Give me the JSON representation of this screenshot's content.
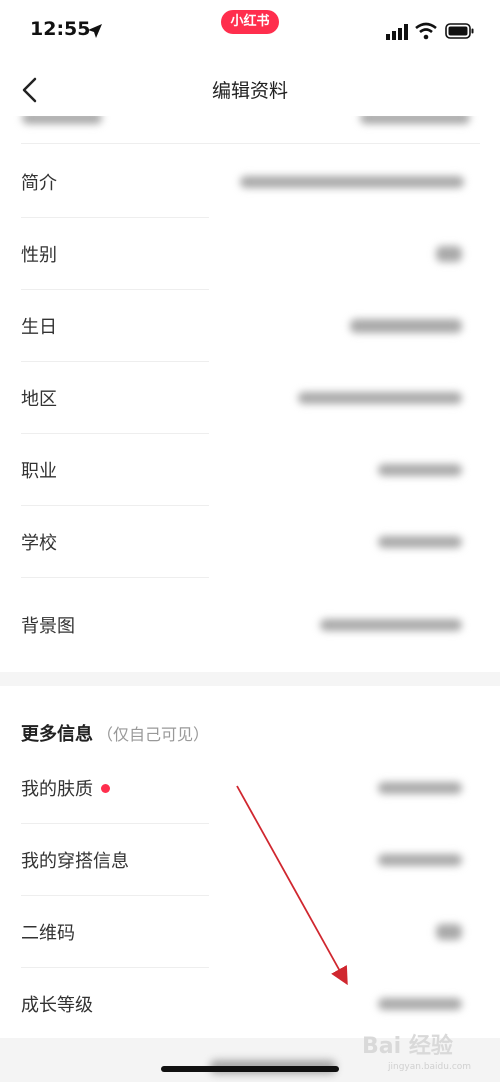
{
  "status_bar": {
    "time": "12:55",
    "app_badge": "小红书"
  },
  "nav": {
    "title": "编辑资料"
  },
  "rows": [
    {
      "label": "简介"
    },
    {
      "label": "性别"
    },
    {
      "label": "生日"
    },
    {
      "label": "地区"
    },
    {
      "label": "职业"
    },
    {
      "label": "学校"
    },
    {
      "label": "背景图"
    }
  ],
  "more_section": {
    "title": "更多信息",
    "subtitle": "（仅自己可见）"
  },
  "more_rows": [
    {
      "label": "我的肤质"
    },
    {
      "label": "我的穿搭信息"
    },
    {
      "label": "二维码"
    },
    {
      "label": "成长等级"
    }
  ],
  "watermark": {
    "text": "Bai 经验",
    "sub": "jingyan.baidu.com"
  },
  "colors": {
    "accent": "#ff2e4d",
    "annotation_arrow": "#d0272f"
  }
}
